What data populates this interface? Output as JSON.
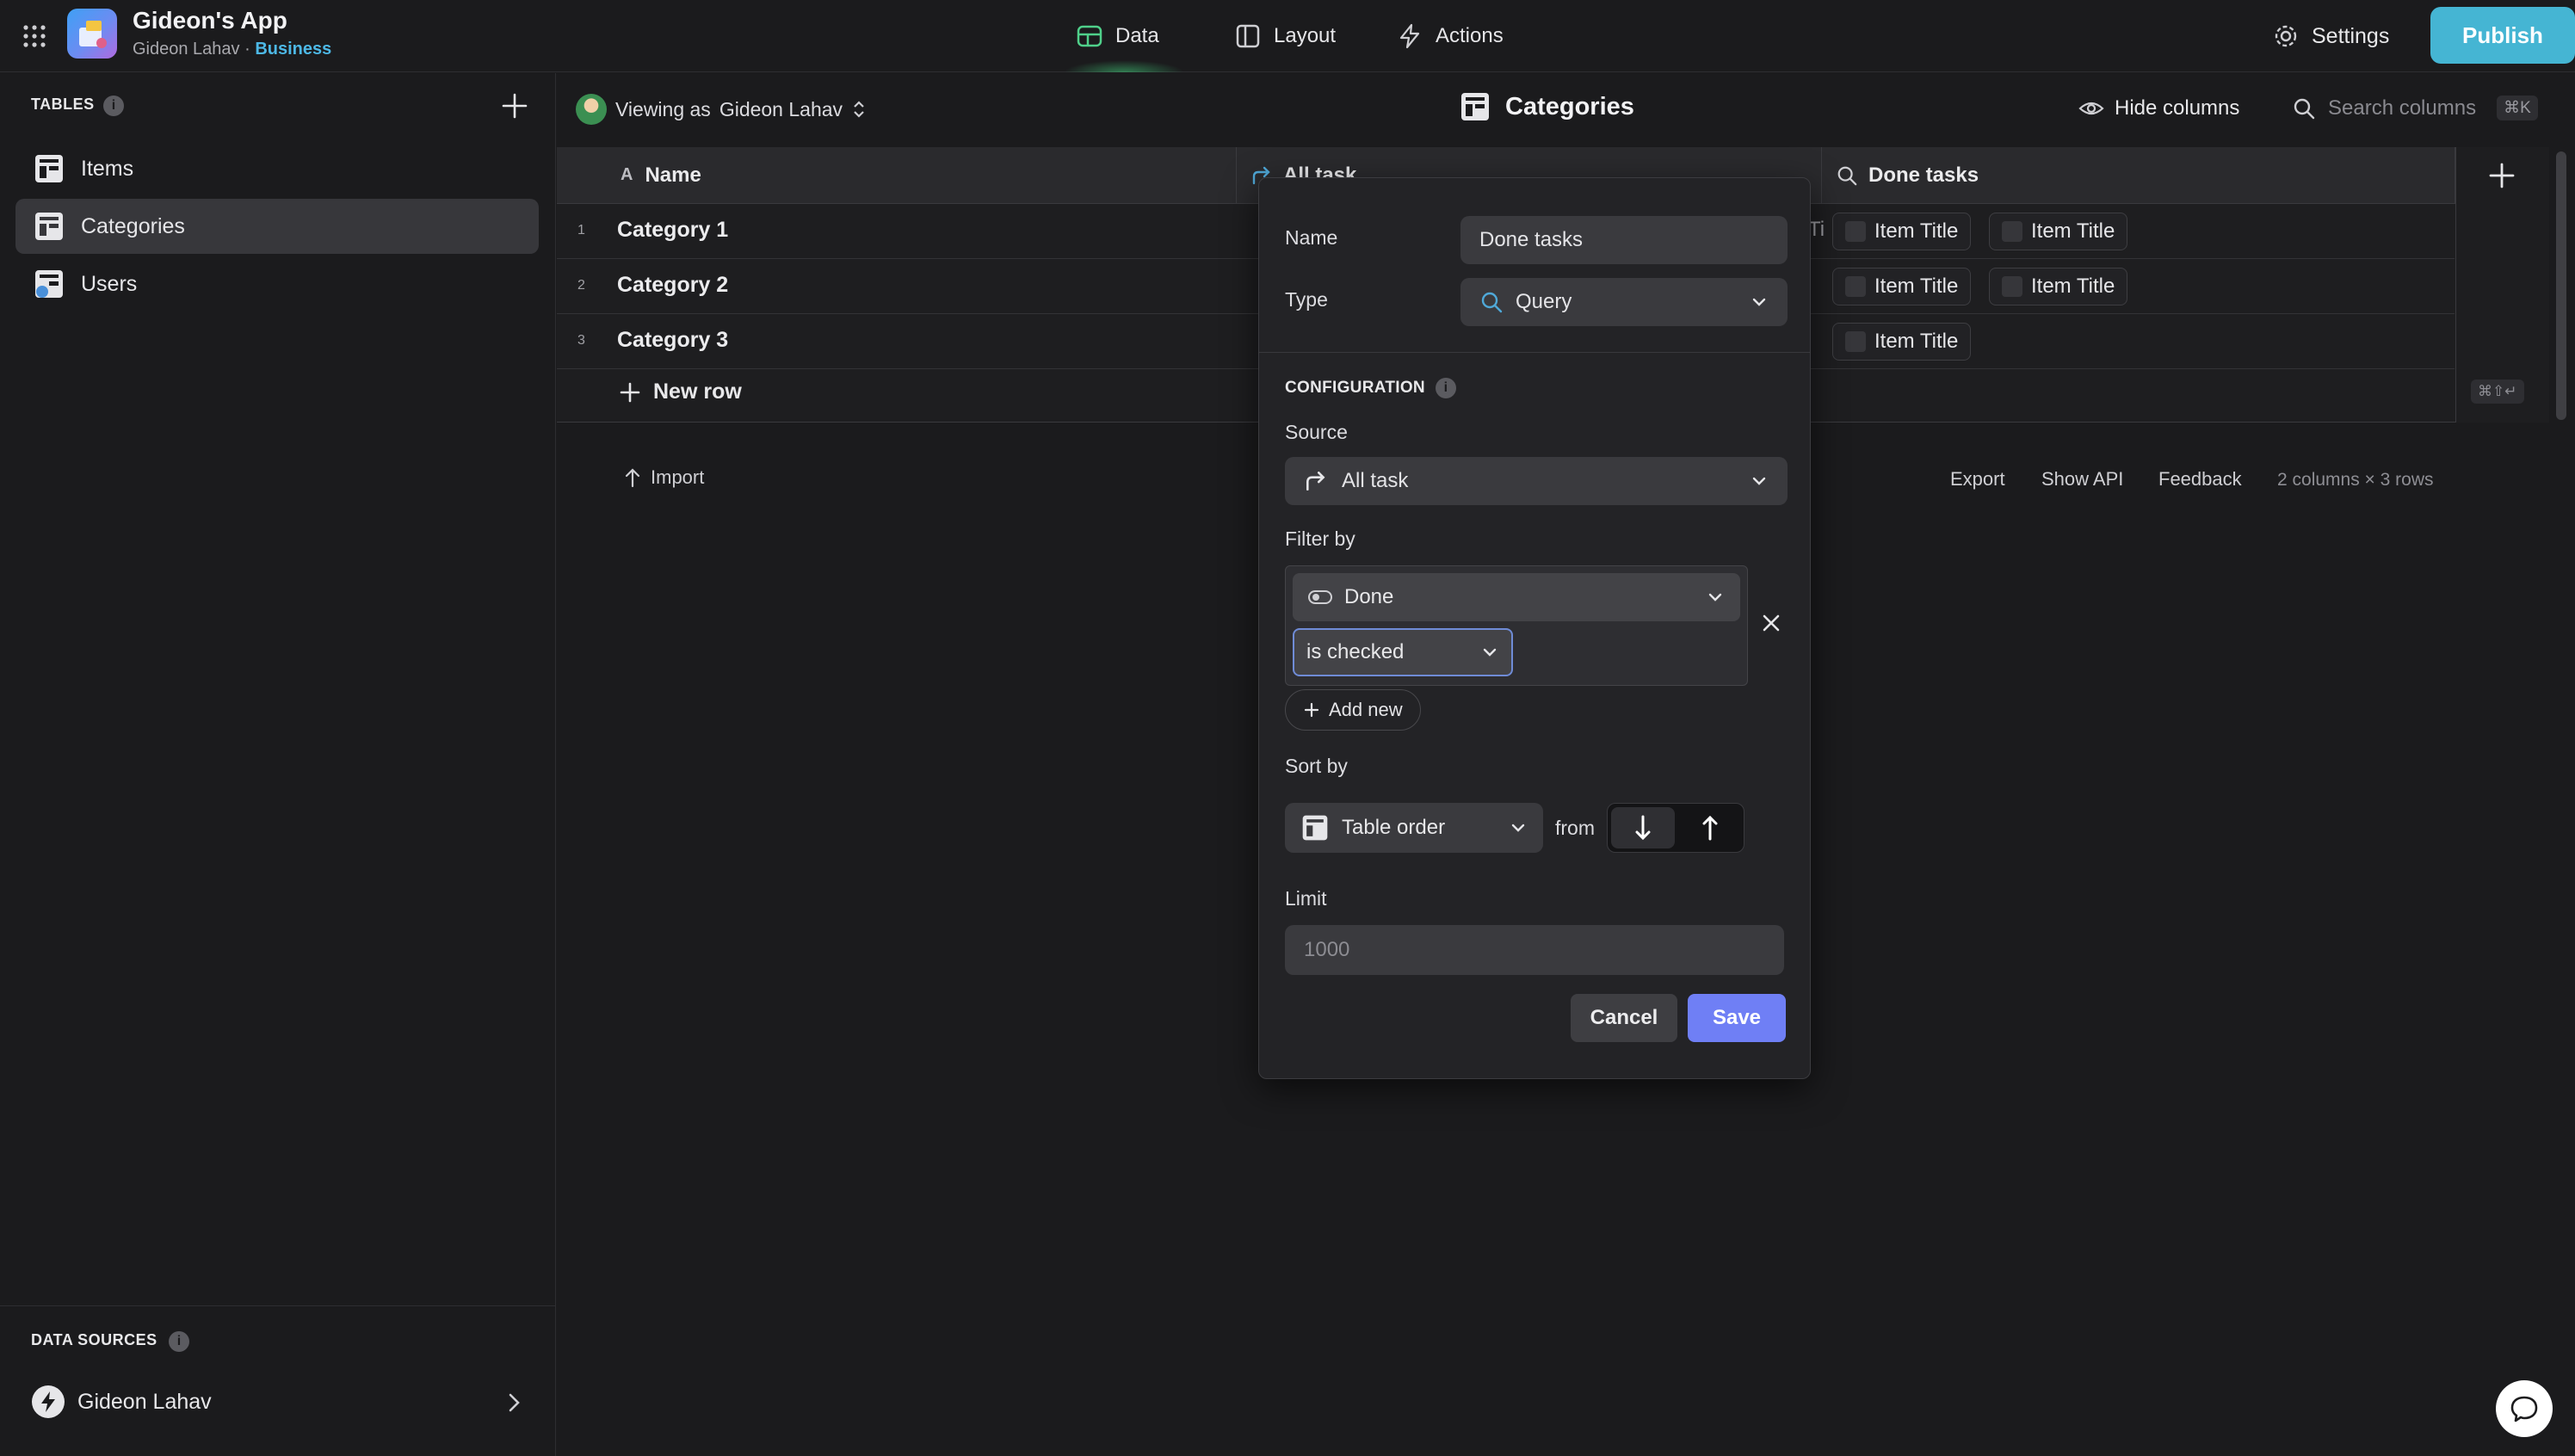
{
  "app": {
    "title": "Gideon's App",
    "owner": "Gideon Lahav",
    "separator": "·",
    "plan": "Business"
  },
  "nav": {
    "data": "Data",
    "layout": "Layout",
    "actions": "Actions",
    "settings": "Settings",
    "publish": "Publish",
    "accent": "#45b5d3"
  },
  "sidebar": {
    "tables_label": "TABLES",
    "info": "i",
    "items": [
      {
        "label": "Items"
      },
      {
        "label": "Categories",
        "active": true
      },
      {
        "label": "Users"
      }
    ],
    "data_sources_label": "DATA SOURCES",
    "data_source": "Gideon Lahav"
  },
  "viewbar": {
    "viewing_prefix": "Viewing as",
    "viewing_user": "Gideon Lahav",
    "title": "Categories",
    "hide_columns": "Hide columns",
    "search_placeholder": "Search columns",
    "search_shortcut": "⌘K"
  },
  "table": {
    "columns": [
      {
        "label": "Name",
        "icon": "text-icon"
      },
      {
        "label": "All task",
        "icon": "relation-icon"
      },
      {
        "label": "Done tasks",
        "icon": "search-icon"
      }
    ],
    "rows": [
      {
        "num": "1",
        "name": "Category 1",
        "done": [
          "Item Title",
          "Item Title"
        ]
      },
      {
        "num": "2",
        "name": "Category 2",
        "done": [
          "Item Title",
          "Item Title"
        ]
      },
      {
        "num": "3",
        "name": "Category 3",
        "done": [
          "Item Title"
        ]
      }
    ],
    "partial_text": "Ti",
    "new_row": "New row",
    "kbd_hint": "⌘⇧↵"
  },
  "footer": {
    "import": "Import",
    "export": "Export",
    "show_api": "Show API",
    "feedback": "Feedback",
    "count": "2 columns × 3 rows"
  },
  "modal": {
    "name_label": "Name",
    "name_value": "Done tasks",
    "type_label": "Type",
    "type_value": "Query",
    "configuration_label": "CONFIGURATION",
    "source_label": "Source",
    "source_value": "All task",
    "filter_label": "Filter by",
    "filter_field": "Done",
    "filter_operator": "is checked",
    "add_new": "Add new",
    "sort_label": "Sort by",
    "sort_field": "Table order",
    "sort_from": "from",
    "limit_label": "Limit",
    "limit_placeholder": "1000",
    "cancel": "Cancel",
    "save": "Save",
    "save_color": "#6f7ff5"
  }
}
